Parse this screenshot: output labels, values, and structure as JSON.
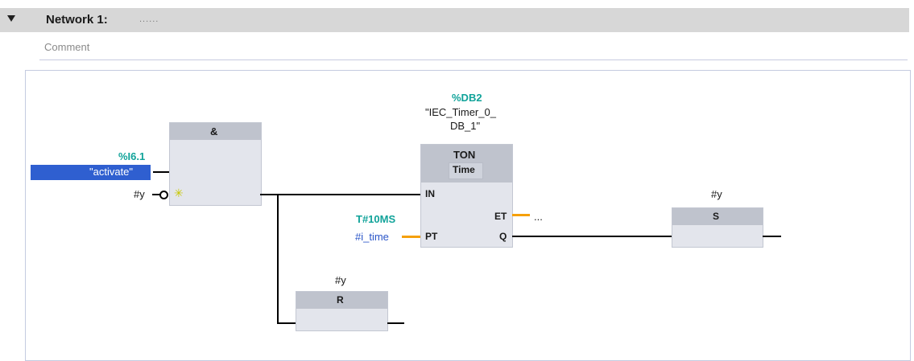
{
  "network": {
    "title": "Network 1:",
    "title_dots": "......",
    "comment": "Comment"
  },
  "and_block": {
    "type_label": "&",
    "input1_address": "%I6.1",
    "input1_tag": "\"activate\"",
    "input2_operand": "#y"
  },
  "timer": {
    "db_address": "%DB2",
    "db_name_line1": "\"IEC_Timer_0_",
    "db_name_line2": "DB_1\"",
    "type": "TON",
    "data_type": "Time",
    "pin_in": "IN",
    "pin_pt": "PT",
    "pin_et": "ET",
    "pin_q": "Q",
    "pt_constant": "T#10MS",
    "pt_operand": "#i_time",
    "et_operand": "..."
  },
  "set_coil": {
    "operand": "#y",
    "label": "S"
  },
  "reset_coil": {
    "operand": "#y",
    "label": "R"
  },
  "colors": {
    "header_bg": "#d7d7d7",
    "block_body": "#e3e5ec",
    "block_header": "#bfc3cd",
    "address_teal": "#11a39a",
    "tag_highlight": "#2f5fd0",
    "operand_blue": "#2a55c8",
    "param_wire_orange": "#f5a00a"
  }
}
